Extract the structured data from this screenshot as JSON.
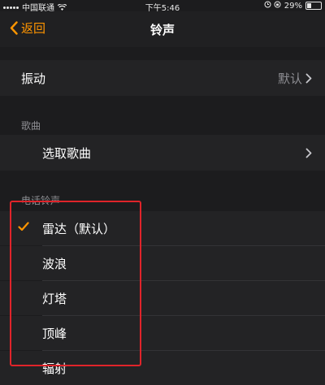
{
  "status_bar": {
    "carrier": "中国联通",
    "time": "下午5:46",
    "battery": "29%",
    "battery_level": 0.29
  },
  "nav": {
    "back_label": "返回",
    "title": "铃声"
  },
  "vibration": {
    "label": "振动",
    "value": "默认"
  },
  "songs_section": {
    "header": "歌曲",
    "pick_label": "选取歌曲"
  },
  "ringtones_section": {
    "header": "电话铃声",
    "items": [
      {
        "label": "雷达（默认）",
        "selected": true
      },
      {
        "label": "波浪",
        "selected": false
      },
      {
        "label": "灯塔",
        "selected": false
      },
      {
        "label": "顶峰",
        "selected": false
      },
      {
        "label": "辐射",
        "selected": false
      }
    ]
  },
  "colors": {
    "accent": "#ff9500",
    "background": "#1c1c1e",
    "highlight_box": "#e0242a"
  }
}
